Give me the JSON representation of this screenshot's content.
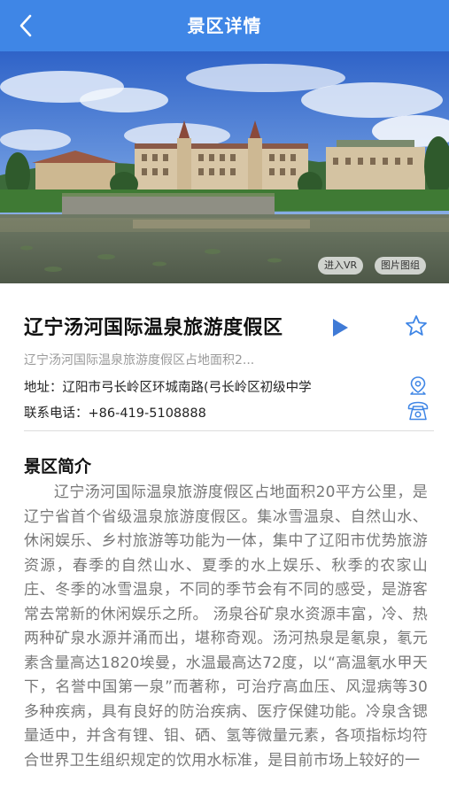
{
  "header": {
    "title": "景区详情",
    "accent_color": "#3f86e6"
  },
  "hero": {
    "vr_button": "进入VR",
    "gallery_button": "图片图组"
  },
  "spot": {
    "name": "辽宁汤河国际温泉旅游度假区",
    "summary": "辽宁汤河国际温泉旅游度假区占地面积2...",
    "address_label": "地址：",
    "address": "辽阳市弓长岭区环城南路(弓长岭区初级中学",
    "phone_label": "联系电话：",
    "phone": "+86-419-5108888"
  },
  "intro": {
    "heading": "景区简介",
    "text": "辽宁汤河国际温泉旅游度假区占地面积20平方公里，是辽宁省首个省级温泉旅游度假区。集冰雪温泉、自然山水、休闲娱乐、乡村旅游等功能为一体，集中了辽阳市优势旅游资源，春季的自然山水、夏季的水上娱乐、秋季的农家山庄、冬季的冰雪温泉，不同的季节会有不同的感受，是游客常去常新的休闲娱乐之所。 汤泉谷矿泉水资源丰富，冷、热两种矿泉水源并涌而出，堪称奇观。汤河热泉是氡泉，氡元素含量高达1820埃曼，水温最高达72度，以“高温氡水甲天下，名誉中国第一泉”而著称，可治疗高血压、风湿病等30多种疾病，具有良好的防治疾病、医疗保健功能。冷泉含锶量适中，并含有锂、钼、硒、氢等微量元素，各项指标均符合世界卫生组织规定的饮用水标准，是目前市场上较好的一"
  },
  "icons": {
    "back": "chevron-left-icon",
    "play": "play-icon",
    "favorite": "star-outline-icon",
    "location": "location-pin-icon",
    "phone": "telephone-icon"
  }
}
